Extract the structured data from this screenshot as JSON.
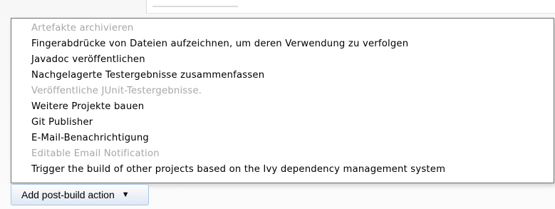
{
  "menu": {
    "items": [
      {
        "label": "Artefakte archivieren",
        "enabled": false
      },
      {
        "label": "Fingerabdrücke von Dateien aufzeichnen, um deren Verwendung zu verfolgen",
        "enabled": true
      },
      {
        "label": "Javadoc veröffentlichen",
        "enabled": true
      },
      {
        "label": "Nachgelagerte Testergebnisse zusammenfassen",
        "enabled": true
      },
      {
        "label": "Veröffentliche JUnit-Testergebnisse.",
        "enabled": false
      },
      {
        "label": "Weitere Projekte bauen",
        "enabled": true
      },
      {
        "label": "Git Publisher",
        "enabled": true
      },
      {
        "label": "E-Mail-Benachrichtigung",
        "enabled": true
      },
      {
        "label": "Editable Email Notification",
        "enabled": false
      },
      {
        "label": "Trigger the build of other projects based on the Ivy dependency management system",
        "enabled": true
      }
    ]
  },
  "button": {
    "label": "Add post-build action",
    "arrow_icon": "triangle-down-icon",
    "arrow": "▼"
  }
}
